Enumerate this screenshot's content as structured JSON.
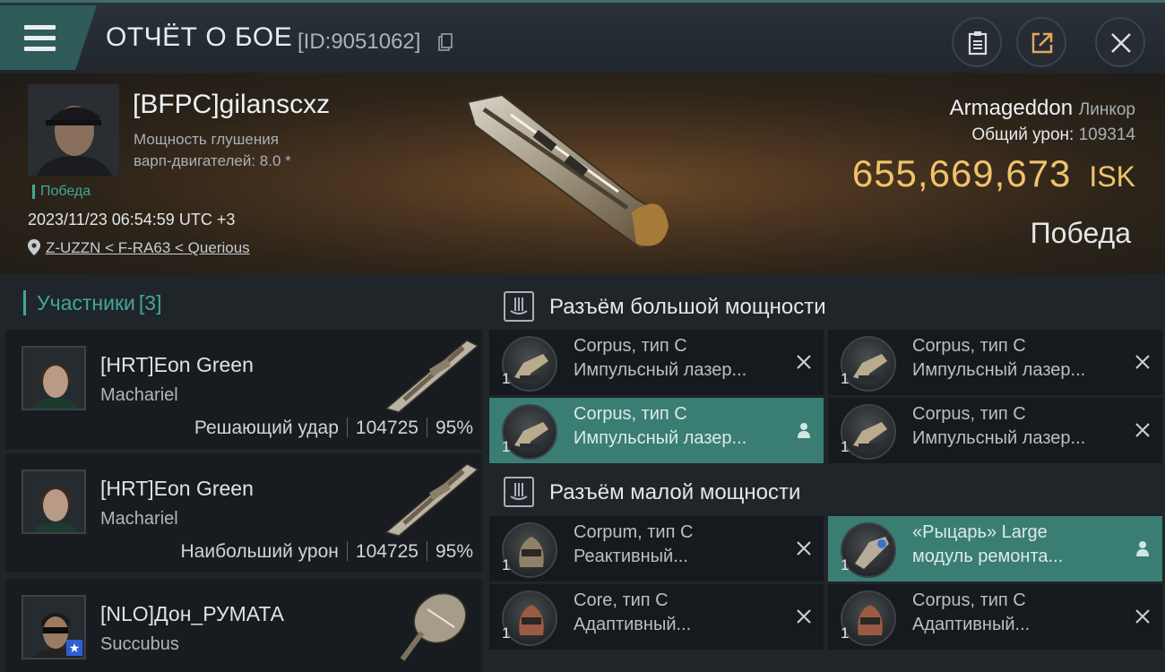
{
  "header": {
    "title": "ОТЧЁТ О БОЕ",
    "report_id": "[ID:9051062]"
  },
  "icons": {
    "menu": "hamburger-menu-icon",
    "copy": "copy-icon",
    "clipboard": "clipboard-icon",
    "share": "share-icon",
    "close": "close-icon",
    "location": "location-pin-icon",
    "slot": "slot-icon",
    "remove": "remove-x-icon",
    "person": "person-icon"
  },
  "victim": {
    "name": "[BFPC]gilanscxz",
    "stat_line1": "Мощность глушения",
    "stat_line2": "варп-двигателей: 8.0 *",
    "result_badge": "Победа",
    "datetime": "2023/11/23 06:54:59 UTC +3",
    "location": "Z-UZZN < F-RA63 < Querious",
    "ship_name": "Armageddon",
    "ship_class": "Линкор",
    "total_damage_label": "Общий урон:",
    "total_damage": "109314",
    "isk_value": "655,669,673",
    "isk_unit": "ISK",
    "outcome": "Победа"
  },
  "participants": {
    "label": "Участники",
    "count": "[3]",
    "items": [
      {
        "name": "[HRT]Eon Green",
        "ship": "Machariel",
        "role": "Решающий удар",
        "damage": "104725",
        "percent": "95%"
      },
      {
        "name": "[HRT]Eon Green",
        "ship": "Machariel",
        "role": "Наибольший урон",
        "damage": "104725",
        "percent": "95%"
      },
      {
        "name": "[NLO]Дон_РУМАТА",
        "ship": "Succubus"
      }
    ]
  },
  "fitting": {
    "high_slots_title": "Разъём большой мощности",
    "low_slots_title": "Разъём малой мощности",
    "high": [
      {
        "line1": "Corpus, тип C",
        "line2": "Импульсный лазер...",
        "qty": "1",
        "active": false
      },
      {
        "line1": "Corpus, тип C",
        "line2": "Импульсный лазер...",
        "qty": "1",
        "active": false
      },
      {
        "line1": "Corpus, тип C",
        "line2": "Импульсный лазер...",
        "qty": "1",
        "active": true
      },
      {
        "line1": "Corpus, тип C",
        "line2": "Импульсный лазер...",
        "qty": "1",
        "active": false
      }
    ],
    "low": [
      {
        "line1": "Corpum, тип C",
        "line2": "Реактивный...",
        "qty": "1",
        "active": false
      },
      {
        "line1": "«Рыцарь» Large",
        "line2": "модуль ремонта...",
        "qty": "1",
        "active": true
      },
      {
        "line1": "Core, тип C",
        "line2": "Адаптивный...",
        "qty": "1",
        "active": false
      },
      {
        "line1": "Corpus, тип C",
        "line2": "Адаптивный...",
        "qty": "1",
        "active": false
      }
    ]
  },
  "colors": {
    "accent_teal": "#3fa997",
    "active_row": "#3a7d73",
    "isk_gold": "#f0c36a",
    "panel": "#20252a"
  }
}
